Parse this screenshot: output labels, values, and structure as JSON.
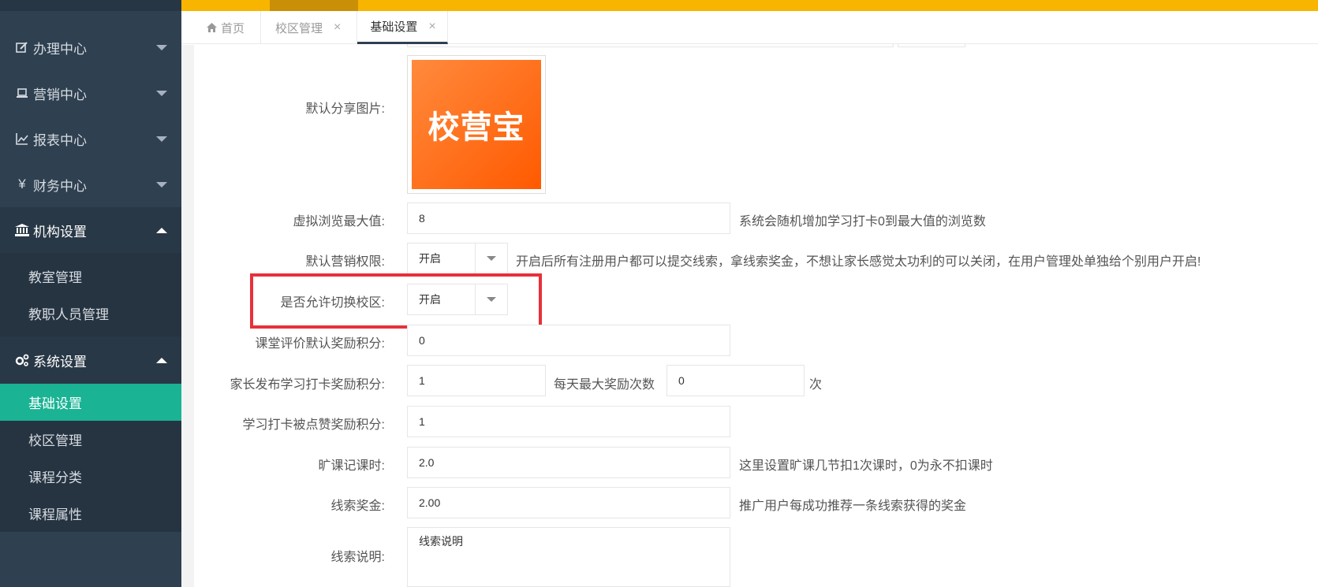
{
  "sidebar": {
    "menus": [
      {
        "label": "办理中心",
        "icon": "edit-icon"
      },
      {
        "label": "营销中心",
        "icon": "laptop-icon"
      },
      {
        "label": "报表中心",
        "icon": "chart-icon"
      },
      {
        "label": "财务中心",
        "icon": "yen-icon",
        "glyph": "¥"
      }
    ],
    "org": {
      "label": "机构设置",
      "icon": "bank-icon",
      "items": [
        "教室管理",
        "教职人员管理"
      ]
    },
    "sys": {
      "label": "系统设置",
      "icon": "gears-icon",
      "items": [
        "基础设置",
        "校区管理",
        "课程分类",
        "课程属性"
      ]
    }
  },
  "tabs": [
    {
      "label": "首页",
      "icon": "home-icon"
    },
    {
      "label": "校区管理",
      "closable": true
    },
    {
      "label": "基础设置",
      "closable": true,
      "active": true
    }
  ],
  "form": {
    "share_image_label": "默认分享图片:",
    "share_image_text": "校营宝",
    "virtual_view_label": "虚拟浏览最大值:",
    "virtual_view_value": "8",
    "virtual_view_hint": "系统会随机增加学习打卡0到最大值的浏览数",
    "marketing_label": "默认营销权限:",
    "marketing_value": "开启",
    "marketing_hint": "开启后所有注册用户都可以提交线索，拿线索奖金，不想让家长感觉太功利的可以关闭，在用户管理处单独给个别用户开启!",
    "switch_campus_label": "是否允许切换校区:",
    "switch_campus_value": "开启",
    "class_eval_label": "课堂评价默认奖励积分:",
    "class_eval_value": "0",
    "parent_post_label": "家长发布学习打卡奖励积分:",
    "parent_post_value": "1",
    "daily_max_label": "每天最大奖励次数",
    "daily_max_value": "0",
    "daily_max_unit": "次",
    "liked_label": "学习打卡被点赞奖励积分:",
    "liked_value": "1",
    "absent_label": "旷课记课时:",
    "absent_value": "2.0",
    "absent_hint": "这里设置旷课几节扣1次课时，0为永不扣课时",
    "lead_bonus_label": "线索奖金:",
    "lead_bonus_value": "2.00",
    "lead_bonus_hint": "推广用户每成功推荐一条线索获得的奖金",
    "lead_desc_label": "线索说明:",
    "lead_desc_value": "线索说明"
  },
  "colors": {
    "sidebar": "#2f4050",
    "active": "#1ab394",
    "topbar": "#f8b500",
    "highlight": "#e8303a"
  }
}
